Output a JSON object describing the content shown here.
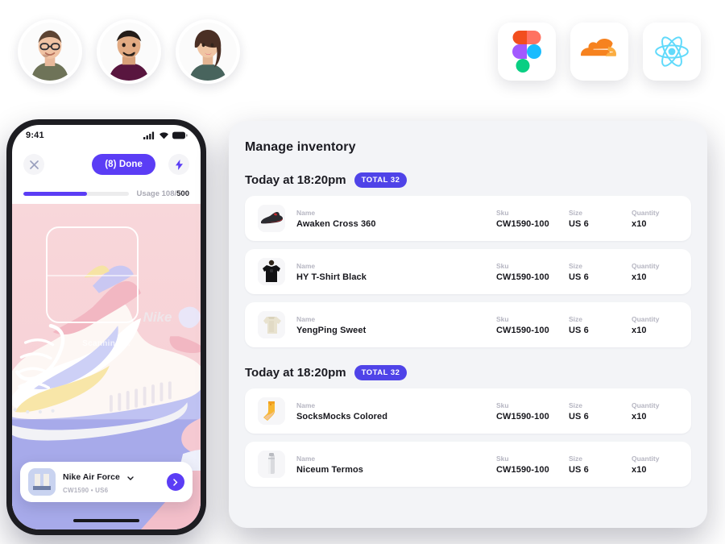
{
  "team": {
    "avatars": [
      {
        "name": "avatar-person-1",
        "alt": "Man with glasses in olive shirt"
      },
      {
        "name": "avatar-person-2",
        "alt": "Man in dark purple turtleneck"
      },
      {
        "name": "avatar-person-3",
        "alt": "Woman with long brown hair in green top"
      }
    ]
  },
  "logos": [
    {
      "name": "figma-logo",
      "label": "Figma"
    },
    {
      "name": "cloudflare-logo",
      "label": "Cloudflare"
    },
    {
      "name": "react-logo",
      "label": "React"
    }
  ],
  "phone": {
    "status": {
      "time": "9:41",
      "signal_icon": "signal-bars-icon",
      "wifi_icon": "wifi-icon",
      "battery_icon": "battery-icon"
    },
    "controls": {
      "close_icon": "close-icon",
      "done_label": "(8) Done",
      "bolt_icon": "lightning-bolt-icon"
    },
    "usage": {
      "text_prefix": "Usage 108/",
      "text_total": "500",
      "percent": 60
    },
    "scanner": {
      "status_text": "Scanning ..."
    },
    "product": {
      "name": "Nike Air Force",
      "subtitle": "CW1590 • US6",
      "chevron_icon": "chevron-down-icon",
      "go_icon": "chevron-right-icon"
    }
  },
  "inventory": {
    "title": "Manage inventory",
    "columns": {
      "name": "Name",
      "sku": "Sku",
      "size": "Size",
      "quantity": "Quantity"
    },
    "groups": [
      {
        "title": "Today at 18:20pm",
        "badge": "TOTAL 32",
        "rows": [
          {
            "thumb": "sneaker-red-thumb",
            "name": "Awaken Cross 360",
            "sku": "CW1590-100",
            "size": "US 6",
            "quantity": "x10"
          },
          {
            "thumb": "tshirt-black-thumb",
            "name": "HY T-Shirt Black",
            "sku": "CW1590-100",
            "size": "US 6",
            "quantity": "x10"
          },
          {
            "thumb": "sweater-cream-thumb",
            "name": "YengPing Sweet",
            "sku": "CW1590-100",
            "size": "US 6",
            "quantity": "x10"
          }
        ]
      },
      {
        "title": "Today at 18:20pm",
        "badge": "TOTAL 32",
        "rows": [
          {
            "thumb": "sock-yellow-thumb",
            "name": "SocksMocks Colored",
            "sku": "CW1590-100",
            "size": "US 6",
            "quantity": "x10"
          },
          {
            "thumb": "thermos-silver-thumb",
            "name": "Niceum Termos",
            "sku": "CW1590-100",
            "size": "US 6",
            "quantity": "x10"
          }
        ]
      }
    ]
  },
  "colors": {
    "accent_purple": "#5b3df5",
    "badge_indigo": "#4f43e8",
    "panel_bg": "#f3f4f7",
    "text_dark": "#17171d",
    "text_muted": "#b6b6c2"
  }
}
